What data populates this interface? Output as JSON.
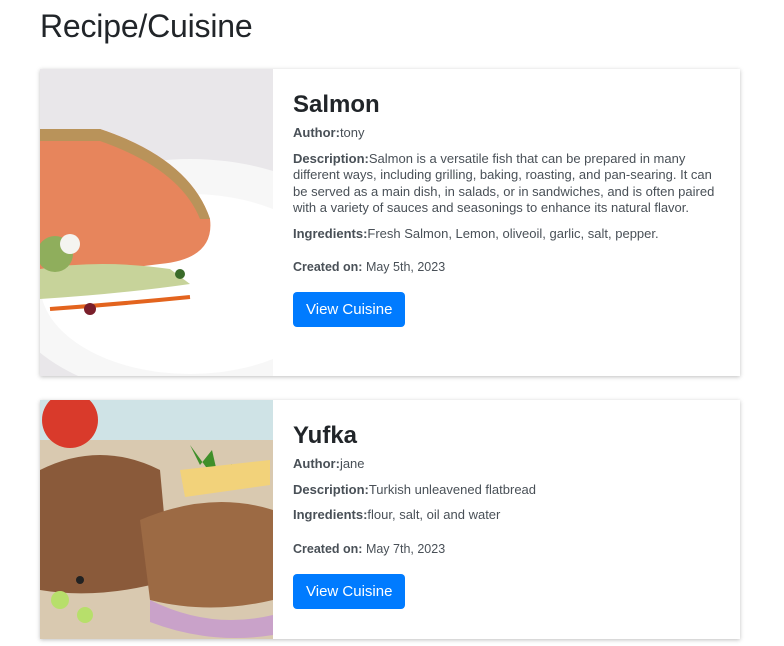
{
  "page": {
    "title": "Recipe/Cuisine"
  },
  "recipes": [
    {
      "name": "Salmon",
      "author_label": "Author:",
      "author": "tony",
      "description_label": "Description:",
      "description": "Salmon is a versatile fish that can be prepared in many different ways, including grilling, baking, roasting, and pan-searing. It can be served as a main dish, in salads, or in sandwiches, and is often paired with a variety of sauces and seasonings to enhance its natural flavor.",
      "ingredients_label": "Ingredients:",
      "ingredients": "Fresh Salmon, Lemon, oliveoil, garlic, salt, pepper.",
      "created_label": "Created on:",
      "created": "May 5th, 2023",
      "button": "View Cuisine"
    },
    {
      "name": "Yufka",
      "author_label": "Author:",
      "author": "jane",
      "description_label": "Description:",
      "description": "Turkish unleavened flatbread",
      "ingredients_label": "Ingredients:",
      "ingredients": "flour, salt, oil and water",
      "created_label": "Created on:",
      "created": "May 7th, 2023",
      "button": "View Cuisine"
    }
  ],
  "colors": {
    "accent": "#007bff",
    "text": "#212529",
    "muted": "#495057"
  }
}
